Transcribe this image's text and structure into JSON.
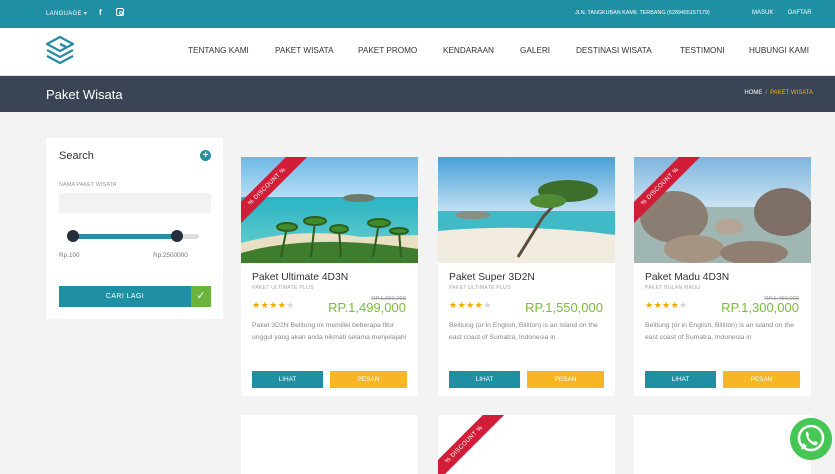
{
  "topbar": {
    "language": "LANGUAGE ▾",
    "address": "JLN. TANGKUBAN KAMIL TERBANG (6289455157179)",
    "login": "MASUK",
    "register": "DAFTAR"
  },
  "nav": {
    "items": [
      "TENTANG KAMI",
      "PAKET WISATA",
      "PAKET PROMO",
      "KENDARAAN",
      "GALERI",
      "DESTINASI WISATA",
      "TESTIMONI",
      "HUBUNGI KAMI"
    ]
  },
  "page": {
    "title": "Paket Wisata",
    "breadcrumb_home": "HOME",
    "breadcrumb_current": "PAKET WISATA"
  },
  "search": {
    "heading": "Search",
    "field_label": "NAMA PAKET WISATA",
    "field_value": "",
    "range_min": "Rp.100",
    "range_max": "Rp.2500000",
    "button_label": "CARI LAGI"
  },
  "cards": [
    {
      "ribbon": "% DISCOUNT %",
      "name": "Paket Ultimate 4D3N",
      "subtitle": "PAKET ULTIMATE PLUS",
      "rating": 4,
      "old_price": "RP.1,650,000",
      "price": "RP.1,499,000",
      "description": "Paket 3D2N Belitung ini memiliki beberapa fitur unggul yang akan anda nikmati selama menjelajahi",
      "view_label": "LIHAT",
      "order_label": "PESAN"
    },
    {
      "ribbon": "",
      "name": "Paket Super 3D2N",
      "subtitle": "PAKET ULTIMATE PLUS",
      "rating": 4,
      "old_price": "",
      "price": "RP.1,550,000",
      "description": "Belitung (or in English, Billiton) is an island on the east coast of Sumatra, Indonesia in",
      "view_label": "LIHAT",
      "order_label": "PESAN"
    },
    {
      "ribbon": "% DISCOUNT %",
      "name": "Paket Madu 4D3N",
      "subtitle": "PAKET BULAN MADU",
      "rating": 4,
      "old_price": "RP.1,450,000",
      "price": "RP.1,300,000",
      "description": "Belitung (or in English, Billiton) is an island on the east coast of Sumatra, Indonesia in",
      "view_label": "LIHAT",
      "order_label": "PESAN"
    }
  ],
  "second_row_ribbon": "% DISCOUNT %",
  "icons": {
    "facebook": "facebook-icon",
    "instagram": "instagram-icon",
    "whatsapp": "whatsapp-icon"
  },
  "colors": {
    "primary": "#1f8fa4",
    "dark": "#3b4454",
    "price": "#7bbd3d",
    "order": "#f8b524",
    "ribbon": "#d11d38"
  }
}
